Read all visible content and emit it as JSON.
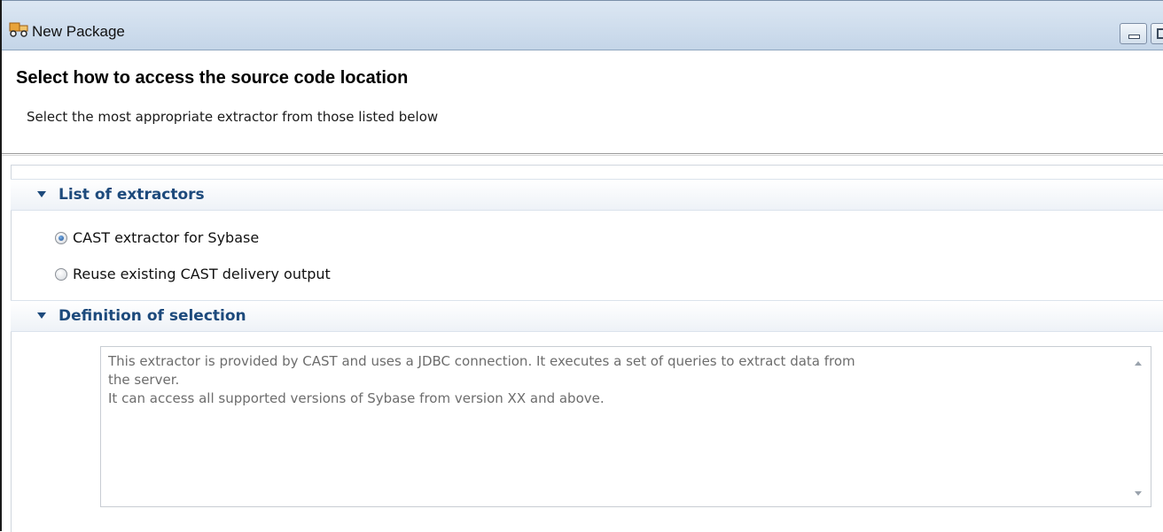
{
  "window": {
    "title": "New Package",
    "icon": "package-truck-icon"
  },
  "header": {
    "title": "Select how to access the source code location",
    "description": "Select the most appropriate extractor from those listed below"
  },
  "sections": {
    "extractors": {
      "label": "List of extractors",
      "options": [
        {
          "label": "CAST extractor for Sybase",
          "selected": true
        },
        {
          "label": "Reuse existing CAST delivery output",
          "selected": false
        }
      ]
    },
    "definition": {
      "label": "Definition of selection",
      "text": "This extractor is provided by CAST and uses a JDBC connection. It executes a set of queries to extract data from\nthe server.\nIt can access all supported versions of Sybase from version XX and above."
    }
  },
  "colors": {
    "section_header_text": "#1d4a7c",
    "titlebar": "#c4d5e8",
    "description_text": "#6d6d6d"
  }
}
